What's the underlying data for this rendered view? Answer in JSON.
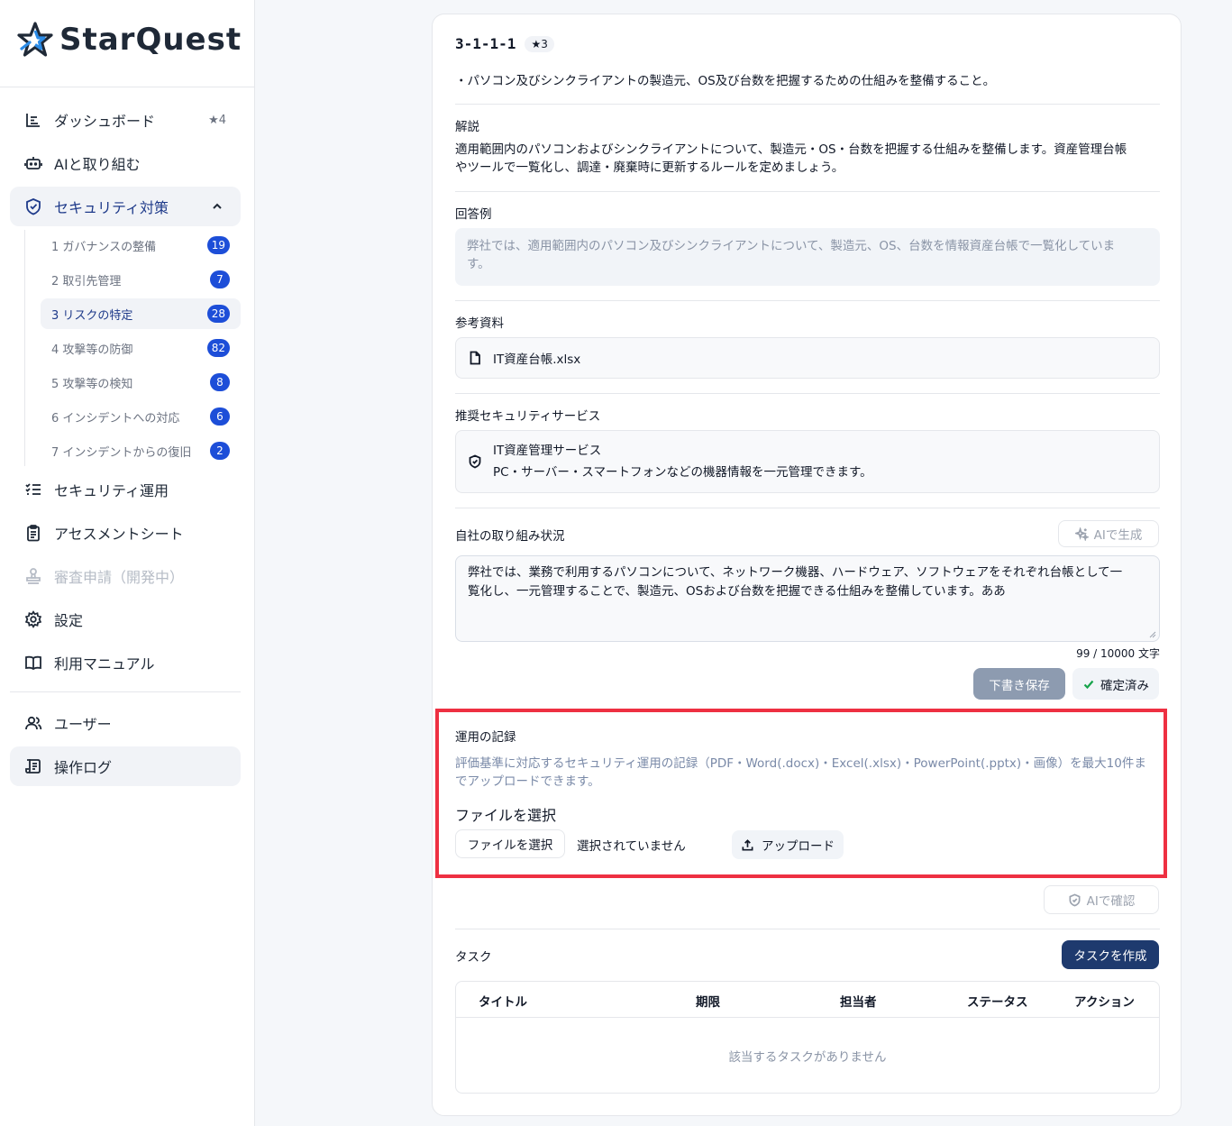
{
  "brand": {
    "name": "StarQuest"
  },
  "sidebar": {
    "items": [
      {
        "label": "ダッシュボード",
        "icon": "dashboard-icon",
        "stars": "★4"
      },
      {
        "label": "AIと取り組む",
        "icon": "robot-icon"
      },
      {
        "label": "セキュリティ対策",
        "icon": "shield-icon"
      },
      {
        "label": "セキュリティ運用",
        "icon": "checklist-icon"
      },
      {
        "label": "アセスメントシート",
        "icon": "clipboard-icon"
      },
      {
        "label": "審査申請（開発中）",
        "icon": "stamp-icon"
      },
      {
        "label": "設定",
        "icon": "gear-icon"
      },
      {
        "label": "利用マニュアル",
        "icon": "book-icon"
      }
    ],
    "subitems": [
      {
        "label": "1 ガバナンスの整備",
        "count": "19"
      },
      {
        "label": "2 取引先管理",
        "count": "7"
      },
      {
        "label": "3 リスクの特定",
        "count": "28"
      },
      {
        "label": "4 攻撃等の防御",
        "count": "82"
      },
      {
        "label": "5 攻撃等の検知",
        "count": "8"
      },
      {
        "label": "6 インシデントへの対応",
        "count": "6"
      },
      {
        "label": "7 インシデントからの復旧",
        "count": "2"
      }
    ],
    "bottom_items": [
      {
        "label": "ユーザー",
        "icon": "users-icon"
      },
      {
        "label": "操作ログ",
        "icon": "log-icon"
      }
    ]
  },
  "question": {
    "code": "3-1-1-1",
    "stars": "★3",
    "requirement": "・パソコン及びシンクライアントの製造元、OS及び台数を把握するための仕組みを整備すること。"
  },
  "explanation": {
    "label": "解説",
    "line1": "適用範囲内のパソコンおよびシンクライアントについて、製造元・OS・台数を把握する仕組みを整備します。資産管理台帳",
    "line2": "やツールで一覧化し、調達・廃棄時に更新するルールを定めましょう。"
  },
  "example": {
    "label": "回答例",
    "line1": "弊社では、適用範囲内のパソコン及びシンクライアントについて、製造元、OS、台数を情報資産台帳で一覧化していま",
    "line2": "す。"
  },
  "references": {
    "label": "参考資料",
    "file": "IT資産台帳.xlsx"
  },
  "services": {
    "label": "推奨セキュリティサービス",
    "name": "IT資産管理サービス",
    "description": "PC・サーバー・スマートフォンなどの機器情報を一元管理できます。"
  },
  "status": {
    "label": "自社の取り組み状況",
    "ai_generate": "AIで生成",
    "text_line1": "弊社では、業務で利用するパソコンについて、ネットワーク機器、ハードウェア、ソフトウェアをそれぞれ台帳として一",
    "text_line2": "覧化し、一元管理することで、製造元、OSおよび台数を把握できる仕組みを整備しています。ああ",
    "counter": "99 / 10000 文字",
    "draft_save": "下書き保存",
    "confirmed": "確定済み"
  },
  "records": {
    "label": "運用の記録",
    "note_line1": "評価基準に対応するセキュリティ運用の記録（PDF・Word(.docx)・Excel(.xlsx)・PowerPoint(.pptx)・画像）を最大10件ま",
    "note_line2": "でアップロードできます。",
    "file_heading": "ファイルを選択",
    "choose_file": "ファイルを選択",
    "no_file": "選択されていません",
    "upload": "アップロード",
    "ai_check": "AIで確認"
  },
  "tasks": {
    "label": "タスク",
    "create": "タスクを作成",
    "columns": [
      "タイトル",
      "期限",
      "担当者",
      "ステータス",
      "アクション"
    ],
    "empty": "該当するタスクがありません"
  }
}
